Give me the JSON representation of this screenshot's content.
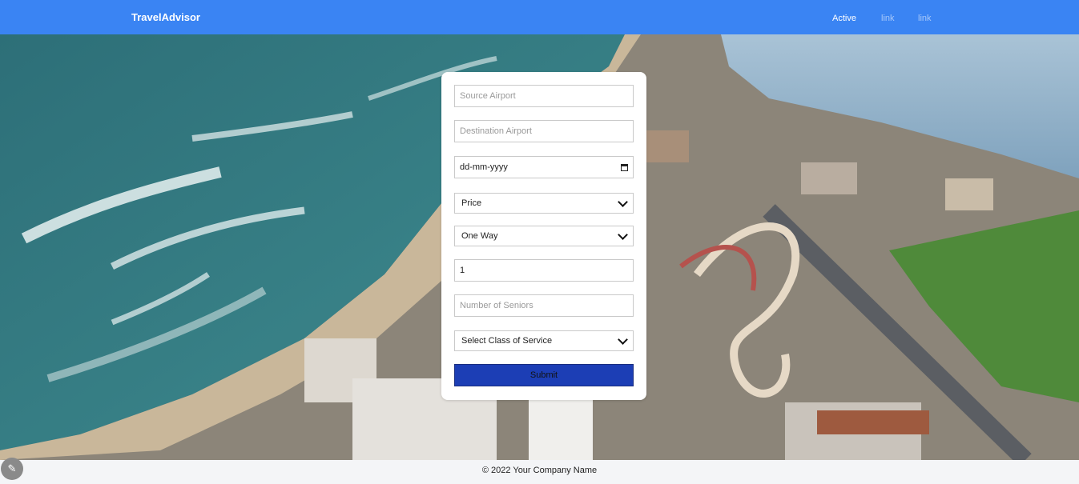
{
  "navbar": {
    "brand": "TravelAdvisor",
    "links": [
      "Active",
      "link",
      "link"
    ]
  },
  "form": {
    "source_placeholder": "Source Airport",
    "destination_placeholder": "Destination Airport",
    "date_placeholder": "dd-mm-yyyy",
    "price_selected": "Price",
    "trip_type_selected": "One Way",
    "passengers_value": "1",
    "seniors_placeholder": "Number of Seniors",
    "class_selected": "Select Class of Service",
    "submit_label": "Submit"
  },
  "footer": {
    "copyright": "© 2022 Your Company Name"
  },
  "colors": {
    "navbar": "#3a84f3",
    "submit": "#1c3eb5"
  }
}
